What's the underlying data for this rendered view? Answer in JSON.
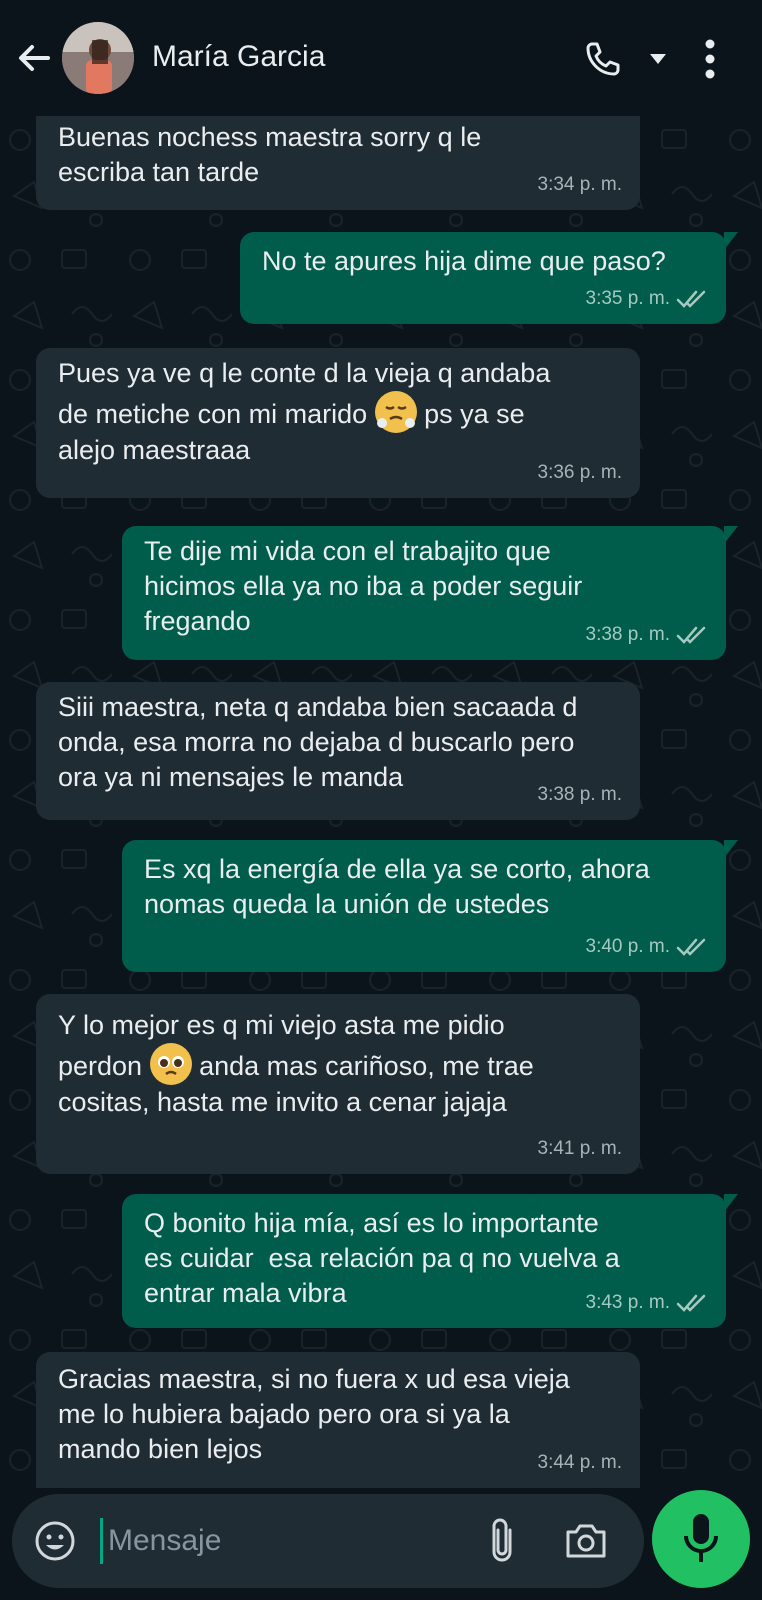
{
  "header": {
    "contact_name": "María Garcia"
  },
  "messages": [
    {
      "direction": "in",
      "text": "Buenas nochess maestra sorry q le\nescriba tan tarde",
      "time": "3:34 p. m."
    },
    {
      "direction": "out",
      "text": "No te apures hija dime que paso?",
      "time": "3:35 p. m."
    },
    {
      "direction": "in",
      "text_before": "Pues ya ve q le conte d la vieja q andaba\nde metiche con mi marido ",
      "emoji": "face-with-steam-from-nose",
      "text_after": " ps ya se\nalejo maestraaa",
      "time": "3:36 p. m."
    },
    {
      "direction": "out",
      "text": "Te dije mi vida con el trabajito que\nhicimos ella ya no iba a poder seguir\nfregando",
      "time": "3:38 p. m."
    },
    {
      "direction": "in",
      "text": "Siii maestra, neta q andaba bien sacaada d\nonda, esa morra no dejaba d buscarlo pero\nora ya ni mensajes le manda",
      "time": "3:38 p. m."
    },
    {
      "direction": "out",
      "text": "Es xq la energía de ella ya se corto, ahora\nnomas queda la unión de ustedes",
      "time": "3:40 p. m."
    },
    {
      "direction": "in",
      "text_before": "Y lo mejor es q mi viejo asta me pidio\nperdon ",
      "emoji": "pleading-face",
      "text_after": " anda mas cariñoso, me trae\ncositas, hasta me invito a cenar jajaja",
      "time": "3:41 p. m."
    },
    {
      "direction": "out",
      "text": "Q bonito hija mía, así es lo importante\nes cuidar  esa relación pa q no vuelva a\nentrar mala vibra",
      "time": "3:43 p. m."
    },
    {
      "direction": "in",
      "text": "Gracias maestra, si no fuera x ud esa vieja\nme lo hubiera bajado pero ora si ya la\nmando bien lejos",
      "time": "3:44 p. m."
    }
  ],
  "composer": {
    "placeholder": "Mensaje"
  },
  "icons": [
    "back-arrow-icon",
    "phone-icon",
    "dropdown-arrow-icon",
    "more-vert-icon",
    "emoji-icon",
    "attach-icon",
    "camera-icon",
    "mic-icon",
    "double-check-icon"
  ],
  "colors": {
    "background": "#0b141a",
    "incoming_bubble": "#202c33",
    "outgoing_bubble": "#005c4b",
    "accent": "#21c063"
  }
}
